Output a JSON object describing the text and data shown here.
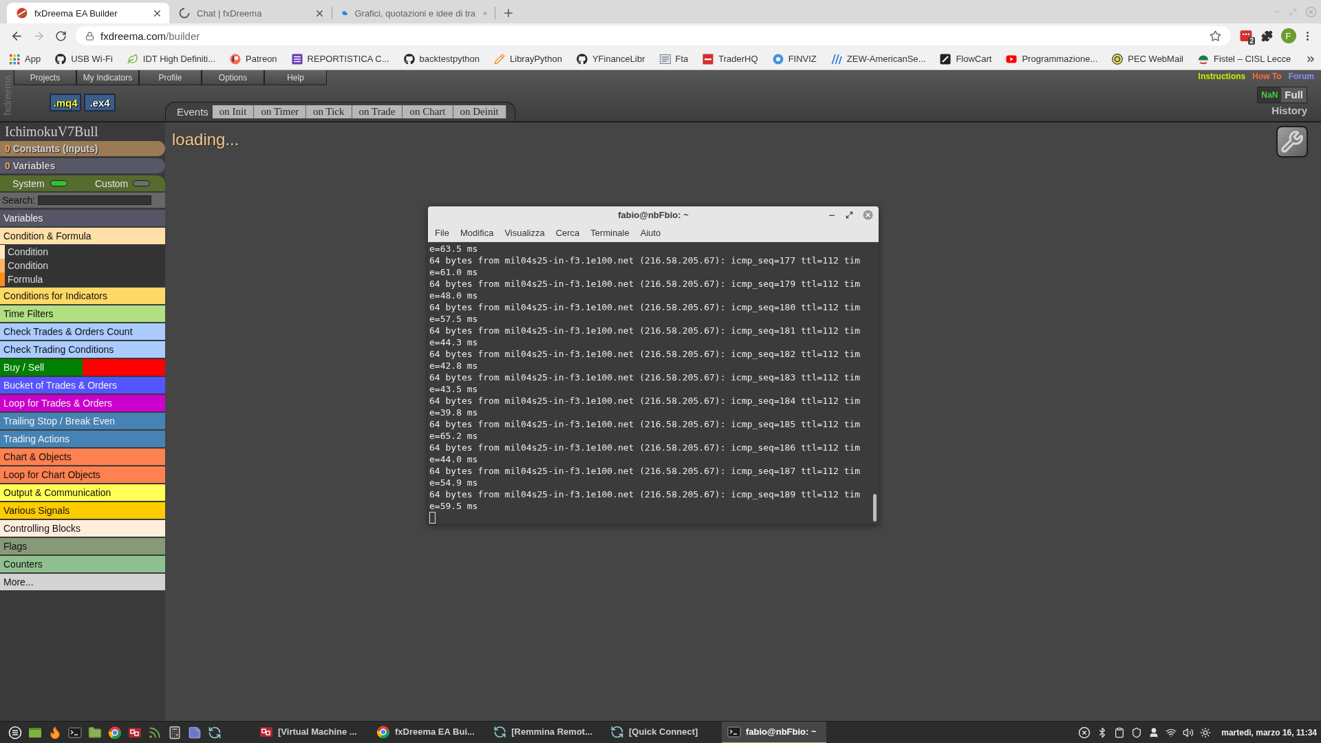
{
  "browser": {
    "tabs": [
      {
        "title": "fxDreema EA Builder",
        "selected": true,
        "loading": false
      },
      {
        "title": "Chat | fxDreema",
        "selected": false,
        "loading": true
      },
      {
        "title": "Grafici, quotazioni e idee di tra",
        "selected": false,
        "loading": false
      }
    ],
    "navigation": {
      "back_disabled": false,
      "forward_disabled": true
    },
    "address": {
      "host": "fxdreema.com",
      "path": "/builder"
    },
    "extension_badge": "2",
    "profile_initial": "F",
    "bookmarks": [
      "App",
      "USB Wi-Fi",
      "IDT High Definiti...",
      "Patreon",
      "REPORTISTICA C...",
      "backtestpython",
      "LibrayPython",
      "YFinanceLibr",
      "Fta",
      "TraderHQ",
      "FINVIZ",
      "ZEW-AmericanSe...",
      "FlowCart",
      "Programmazione...",
      "PEC WebMail",
      "Fistel – CISL Lecce"
    ]
  },
  "app": {
    "brand": "fxdreema",
    "menu": [
      "Projects",
      "My Indicators",
      "Profile",
      "Options",
      "Help"
    ],
    "links": [
      {
        "label": "Instructions",
        "color": "#c8f000"
      },
      {
        "label": "How To",
        "color": "#ff6a3c"
      },
      {
        "label": "Forum",
        "color": "#8c8cff"
      }
    ],
    "file_buttons": [
      {
        "label": ".mq4",
        "kind": "source"
      },
      {
        "label": ".ex4",
        "kind": "compiled"
      }
    ],
    "events": {
      "label": "Events",
      "tabs": [
        {
          "label": "on Init",
          "selected": false
        },
        {
          "label": "on Timer",
          "selected": false
        },
        {
          "label": "on Tick",
          "selected": false
        },
        {
          "label": "on Trade",
          "selected": false
        },
        {
          "label": "on Chart",
          "selected": false
        },
        {
          "label": "on Deinit",
          "selected": false
        }
      ]
    },
    "mode_switch": [
      {
        "label": "NaN",
        "selected": false
      },
      {
        "label": "Full",
        "selected": true
      }
    ],
    "history": "History",
    "loading_text": "loading...",
    "sidebar": {
      "project": "IchimokuV7Bull",
      "constants": {
        "count": "0",
        "label": "Constants (Inputs)"
      },
      "variables": {
        "count": "0",
        "label": "Variables"
      },
      "toggles": [
        {
          "label": "System",
          "on": true
        },
        {
          "label": "Custom",
          "on": false
        }
      ],
      "search_label": "Search:",
      "categories": [
        {
          "label": "Variables",
          "kind": "plain",
          "color": "#555566"
        },
        {
          "label": "Condition & Formula",
          "kind": "plain",
          "color": "#ffe0a8",
          "children": [
            {
              "label": "Condition",
              "color": "#ffe8c4"
            },
            {
              "label": "Condition",
              "color": "#ffb566"
            },
            {
              "label": "Formula",
              "color": "#ff8c1a"
            }
          ]
        },
        {
          "label": "Conditions for Indicators",
          "kind": "plain",
          "color": "#ffd966"
        },
        {
          "label": "Time Filters",
          "kind": "plain",
          "color": "#b0e080"
        },
        {
          "label": "Check Trades & Orders Count",
          "kind": "plain",
          "color": "#aaccff"
        },
        {
          "label": "Check Trading Conditions",
          "kind": "plain",
          "color": "#aaccff"
        },
        {
          "label": "Buy / Sell",
          "kind": "split",
          "color": "#008000",
          "right": {
            "color": "#ff0000"
          }
        },
        {
          "label": "Bucket of Trades & Orders",
          "kind": "plain",
          "color": "#5555ff"
        },
        {
          "label": "Loop for Trades & Orders",
          "kind": "plain",
          "color": "#cc00cc"
        },
        {
          "label": "Trailing Stop / Break Even",
          "kind": "plain",
          "color": "#4682b4"
        },
        {
          "label": "Trading Actions",
          "kind": "plain",
          "color": "#4682b4"
        },
        {
          "label": "Chart & Objects",
          "kind": "plain",
          "color": "#ff8050"
        },
        {
          "label": "Loop for Chart Objects",
          "kind": "plain",
          "color": "#ff8050"
        },
        {
          "label": "Output & Communication",
          "kind": "plain",
          "color": "#ffff55"
        },
        {
          "label": "Various Signals",
          "kind": "plain",
          "color": "#ffcc00"
        },
        {
          "label": "Controlling Blocks",
          "kind": "plain",
          "color": "#ffeedd"
        },
        {
          "label": "Flags",
          "kind": "plain",
          "color": "#889977"
        },
        {
          "label": "Counters",
          "kind": "plain",
          "color": "#90c090"
        },
        {
          "label": "More...",
          "kind": "plain",
          "color": "#d3d3d3"
        }
      ]
    }
  },
  "terminal": {
    "title": "fabio@nbFbio: ~",
    "menu": [
      "File",
      "Modifica",
      "Visualizza",
      "Cerca",
      "Terminale",
      "Aiuto"
    ],
    "lines": [
      "e=63.5 ms",
      "64 bytes from mil04s25-in-f3.1e100.net (216.58.205.67): icmp_seq=177 ttl=112 tim",
      "e=61.0 ms",
      "64 bytes from mil04s25-in-f3.1e100.net (216.58.205.67): icmp_seq=179 ttl=112 tim",
      "e=48.0 ms",
      "64 bytes from mil04s25-in-f3.1e100.net (216.58.205.67): icmp_seq=180 ttl=112 tim",
      "e=57.5 ms",
      "64 bytes from mil04s25-in-f3.1e100.net (216.58.205.67): icmp_seq=181 ttl=112 tim",
      "e=44.3 ms",
      "64 bytes from mil04s25-in-f3.1e100.net (216.58.205.67): icmp_seq=182 ttl=112 tim",
      "e=42.8 ms",
      "64 bytes from mil04s25-in-f3.1e100.net (216.58.205.67): icmp_seq=183 ttl=112 tim",
      "e=43.5 ms",
      "64 bytes from mil04s25-in-f3.1e100.net (216.58.205.67): icmp_seq=184 ttl=112 tim",
      "e=39.8 ms",
      "64 bytes from mil04s25-in-f3.1e100.net (216.58.205.67): icmp_seq=185 ttl=112 tim",
      "e=65.2 ms",
      "64 bytes from mil04s25-in-f3.1e100.net (216.58.205.67): icmp_seq=186 ttl=112 tim",
      "e=44.0 ms",
      "64 bytes from mil04s25-in-f3.1e100.net (216.58.205.67): icmp_seq=187 ttl=112 tim",
      "e=54.9 ms",
      "64 bytes from mil04s25-in-f3.1e100.net (216.58.205.67): icmp_seq=189 ttl=112 tim",
      "e=59.5 ms"
    ]
  },
  "taskbar": {
    "windows": [
      {
        "label": "[Virtual Machine ...",
        "selected": false
      },
      {
        "label": "fxDreema EA Bui...",
        "selected": false
      },
      {
        "label": "[Remmina Remot...",
        "selected": false
      },
      {
        "label": "[Quick Connect]",
        "selected": false
      },
      {
        "label": "fabio@nbFbio: ~",
        "selected": true
      }
    ],
    "clock": "martedì, marzo 16, 11:34"
  }
}
